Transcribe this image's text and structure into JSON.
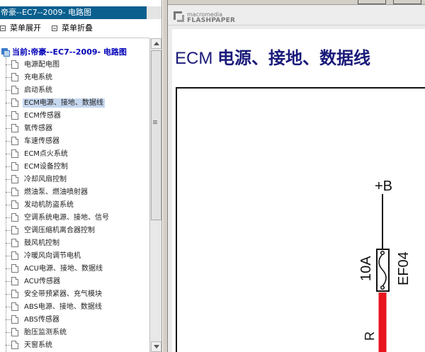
{
  "left_panel": {
    "title": "帝豪--EC7--2009- 电路图",
    "toolbar": {
      "expand_label": "菜单展开",
      "collapse_label": "菜单折叠"
    },
    "tree": {
      "root_label": "当前:帝豪--EC7--2009- 电路图",
      "selected_index": 3,
      "items": [
        {
          "label": "电源配电图"
        },
        {
          "label": "充电系统"
        },
        {
          "label": "启动系统"
        },
        {
          "label": "ECM电源、接地、数据线"
        },
        {
          "label": "ECM传感器"
        },
        {
          "label": "氧传感器"
        },
        {
          "label": "车速传感器"
        },
        {
          "label": "ECM点火系统"
        },
        {
          "label": "ECM设备控制"
        },
        {
          "label": "冷却风扇控制"
        },
        {
          "label": "燃油泵、燃油喷射器"
        },
        {
          "label": "发动机防盗系统"
        },
        {
          "label": "空调系统电源、接地、信号"
        },
        {
          "label": "空调压缩机离合器控制"
        },
        {
          "label": "鼓风机控制"
        },
        {
          "label": "冷暖风向调节电机"
        },
        {
          "label": "ACU电源、接地、数据线"
        },
        {
          "label": "ACU传感器"
        },
        {
          "label": "安全带预紧器、充气模块"
        },
        {
          "label": "ABS电源、接地、数据线"
        },
        {
          "label": "ABS传感器"
        },
        {
          "label": "胎压监测系统"
        },
        {
          "label": "天窗系统"
        }
      ]
    }
  },
  "viewer": {
    "brand_sub": "macromedia",
    "brand_name": "FLASHPAPER",
    "page_title_latin": "ECM ",
    "page_title_cjk": "电源、接地、数据线",
    "diagram": {
      "supply_label": "+B",
      "fuse_rating": "10A",
      "fuse_id": "EF04",
      "wire_color_code": "R",
      "wire_color": "#e8141e"
    }
  },
  "colors": {
    "title_bar": "#0a5f8f",
    "selection": "#c5d7ee",
    "tree_root_text": "#0000b8",
    "page_title_text": "#1a1a7a"
  }
}
